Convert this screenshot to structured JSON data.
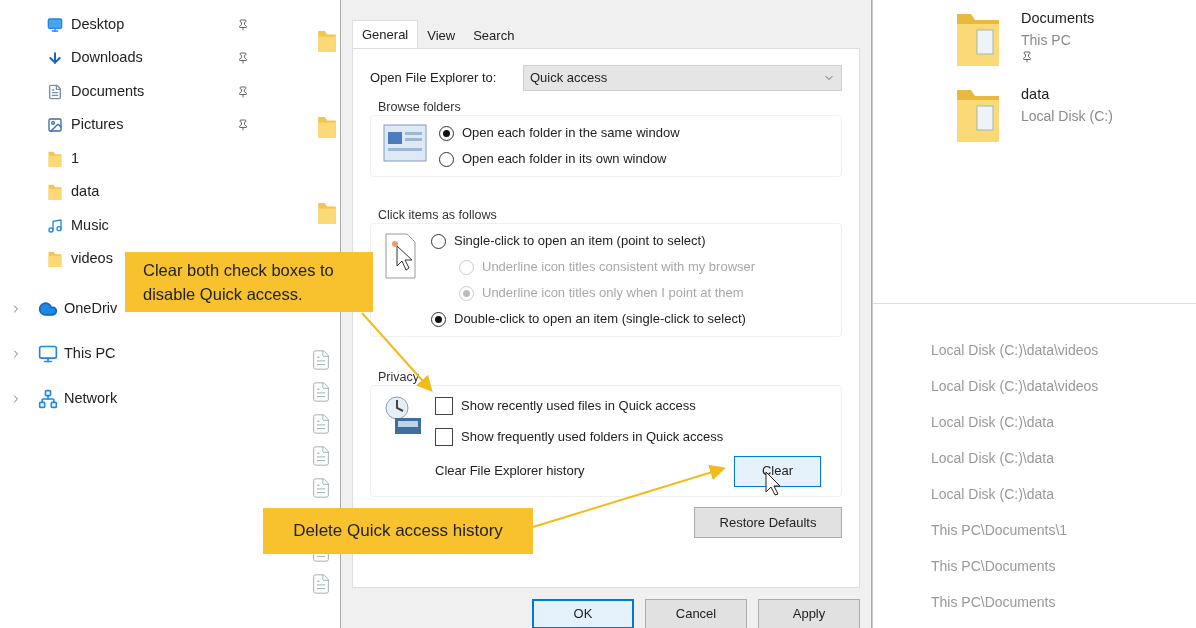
{
  "sidebar": {
    "quick_access": [
      {
        "label": "Desktop",
        "pinned": true
      },
      {
        "label": "Downloads",
        "pinned": true
      },
      {
        "label": "Documents",
        "pinned": true
      },
      {
        "label": "Pictures",
        "pinned": true
      },
      {
        "label": "1",
        "pinned": false
      },
      {
        "label": "data",
        "pinned": false
      },
      {
        "label": "Music",
        "pinned": false
      },
      {
        "label": "videos",
        "pinned": false
      }
    ],
    "roots": [
      {
        "label": "OneDriv",
        "expanded": false
      },
      {
        "label": "This PC",
        "expanded": false
      },
      {
        "label": "Network",
        "expanded": false
      }
    ]
  },
  "dialog": {
    "tabs": [
      {
        "label": "General",
        "selected": true
      },
      {
        "label": "View",
        "selected": false
      },
      {
        "label": "Search",
        "selected": false
      }
    ],
    "open_to": {
      "label": "Open File Explorer to:",
      "value": "Quick access"
    },
    "browse_folders": {
      "title": "Browse folders",
      "options": [
        {
          "label": "Open each folder in the same window",
          "selected": true
        },
        {
          "label": "Open each folder in its own window",
          "selected": false
        }
      ]
    },
    "click_items": {
      "title": "Click items as follows",
      "options": [
        {
          "label": "Single-click to open an item (point to select)",
          "selected": false,
          "disabled": false,
          "sub": false
        },
        {
          "label": "Underline icon titles consistent with my browser",
          "selected": false,
          "disabled": true,
          "sub": true
        },
        {
          "label": "Underline icon titles only when I point at them",
          "selected": true,
          "disabled": true,
          "sub": true
        },
        {
          "label": "Double-click to open an item (single-click to select)",
          "selected": true,
          "disabled": false,
          "sub": false
        }
      ]
    },
    "privacy": {
      "title": "Privacy",
      "checkboxes": [
        {
          "label": "Show recently used files in Quick access",
          "checked": false
        },
        {
          "label": "Show frequently used folders in Quick access",
          "checked": false
        }
      ],
      "history_label": "Clear File Explorer history",
      "clear_button": "Clear"
    },
    "restore_button": "Restore Defaults",
    "buttons": [
      {
        "label": "OK",
        "default": true
      },
      {
        "label": "Cancel",
        "default": false
      },
      {
        "label": "Apply",
        "default": false
      }
    ]
  },
  "pinned_folders": [
    {
      "name": "Documents",
      "location": "This PC",
      "pinned": true
    },
    {
      "name": "data",
      "location": "Local Disk (C:)",
      "pinned": false
    }
  ],
  "recent_locations": [
    "Local Disk (C:)\\data\\videos",
    "Local Disk (C:)\\data\\videos",
    "Local Disk (C:)\\data",
    "Local Disk (C:)\\data",
    "Local Disk (C:)\\data",
    "This PC\\Documents\\1",
    "This PC\\Documents",
    "This PC\\Documents"
  ],
  "callouts": [
    {
      "text": "Clear both check boxes to disable Quick access."
    },
    {
      "text": "Delete Quick access history"
    }
  ]
}
